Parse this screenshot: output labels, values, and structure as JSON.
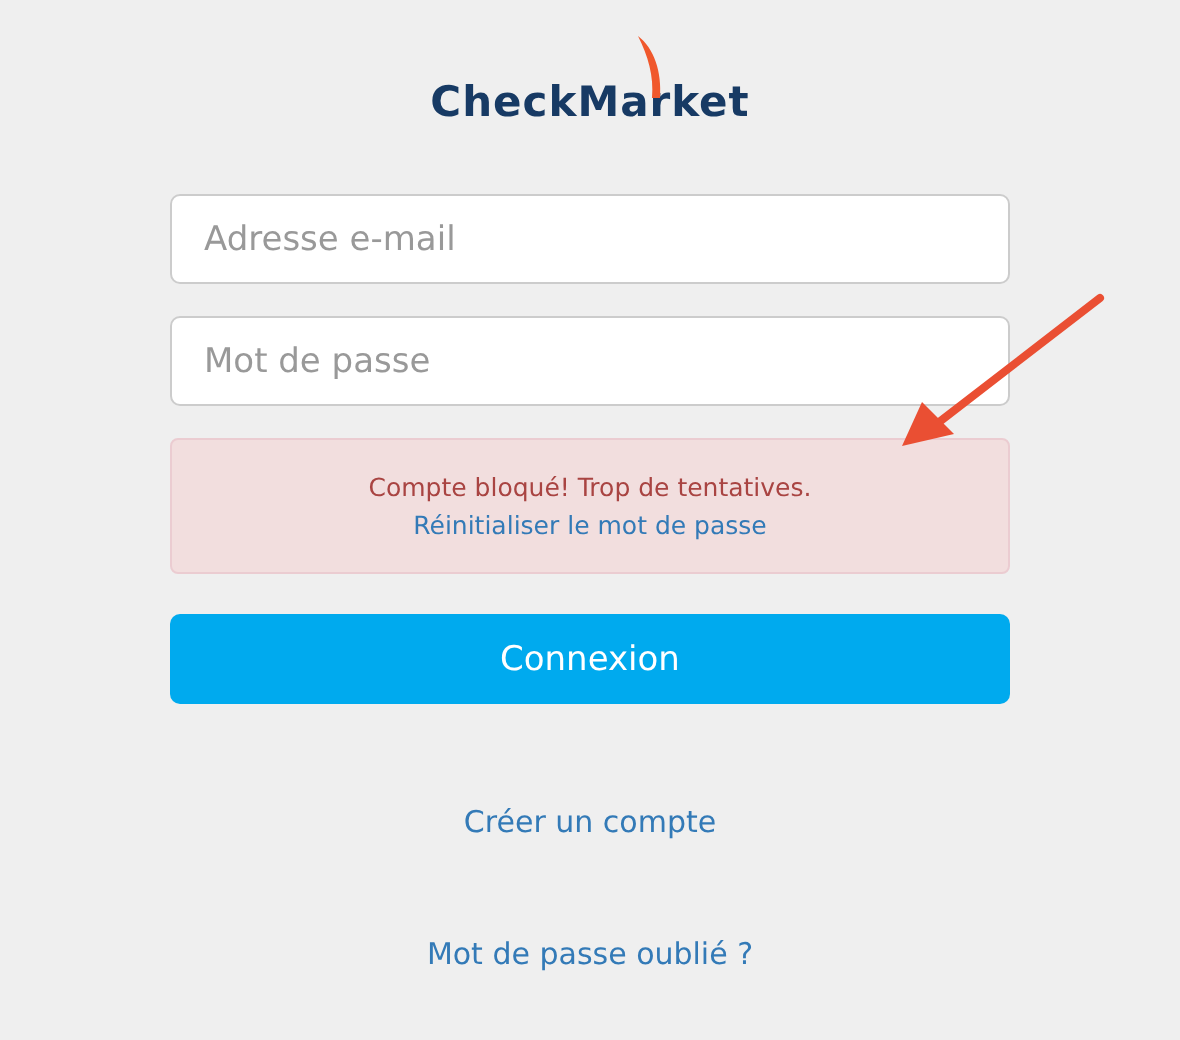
{
  "logo": {
    "text": "CheckMarket"
  },
  "fields": [
    {
      "placeholder": "Adresse e-mail"
    },
    {
      "placeholder": "Mot de passe"
    }
  ],
  "alert": {
    "message": "Compte bloqué! Trop de tentatives.",
    "link": "Réinitialiser le mot de passe"
  },
  "submit": {
    "label": "Connexion"
  },
  "links": [
    "Créer un compte",
    "Mot de passe oublié ?"
  ]
}
